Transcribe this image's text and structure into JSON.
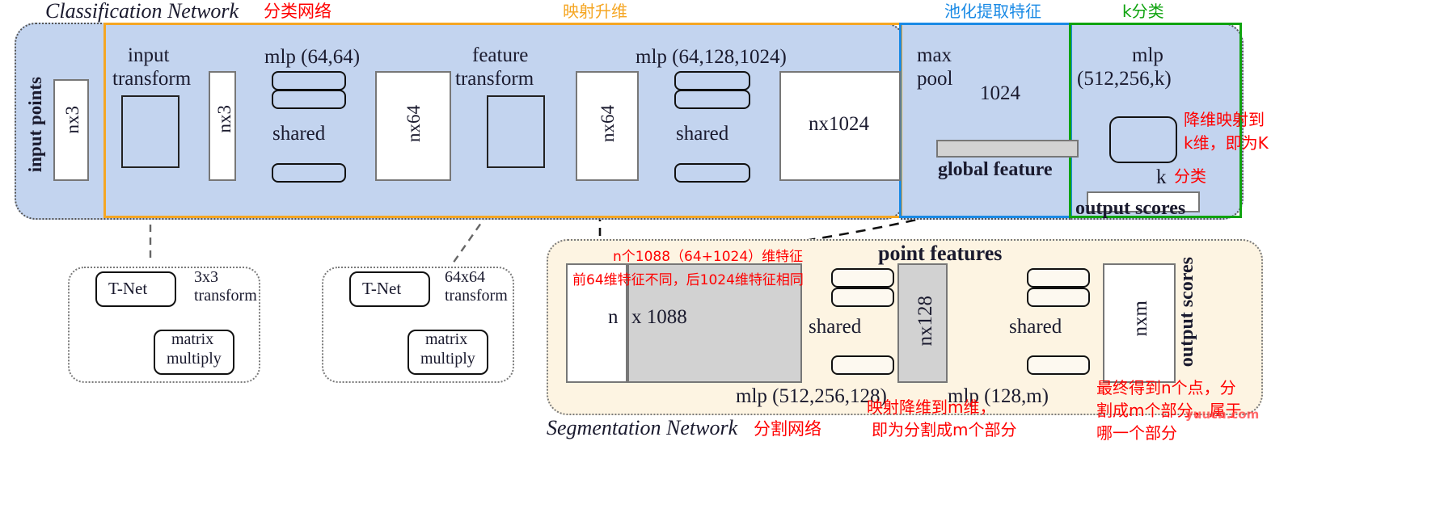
{
  "title": {
    "classification_en": "Classification Network",
    "classification_cn": "分类网络",
    "segmentation_en": "Segmentation Network",
    "segmentation_cn": "分割网络"
  },
  "region_labels": {
    "mapping_up_cn": "映射升维",
    "pooling_cn": "池化提取特征",
    "kclass_cn": "k分类"
  },
  "colors": {
    "orange": "#f5a623",
    "blue": "#1a8ae5",
    "green": "#0fa30f",
    "red": "#ff0000",
    "panel_blue": "#c3d4ef",
    "panel_cream": "#fdf4e2",
    "gray_box": "#d2d2d2"
  },
  "classification": {
    "input_points_label": "input points",
    "input_box": "nx3",
    "input_transform": "input\ntransform",
    "input_transform_line1": "input",
    "input_transform_line2": "transform",
    "after_transform_box": "nx3",
    "mlp1": "mlp (64,64)",
    "shared1": "shared",
    "nx64_a": "nx64",
    "feature_transform_line1": "feature",
    "feature_transform_line2": "transform",
    "nx64_b": "nx64",
    "mlp2": "mlp (64,128,1024)",
    "shared2": "shared",
    "nx1024": "nx1024",
    "max_line1": "max",
    "max_line2": "pool",
    "pool_dim": "1024",
    "global_feature": "global feature",
    "mlp3_line1": "mlp",
    "mlp3_line2": "(512,256,k)",
    "k_label": "k",
    "output_scores": "output scores"
  },
  "annotations_red": {
    "reduce_to_k_line1": "降维映射到",
    "reduce_to_k_line2": "k维，即为K",
    "k_class_cn": "分类",
    "feat_1088_line1": "n个1088（64+1024）维特征",
    "feat_1088_line2": "前64维特征不同，后1024维特征相同",
    "seg_reduce_line1": "映射降维到m维，",
    "seg_reduce_line2": "即为分割成m个部分",
    "seg_final_line1": "最终得到n个点，分",
    "seg_final_line2": "割成m个部分，属于",
    "seg_final_line3": "哪一个部分"
  },
  "tnet_left": {
    "tnet": "T-Net",
    "transform_line1": "3x3",
    "transform_line2": "transform",
    "matrix_line1": "matrix",
    "matrix_line2": "multiply"
  },
  "tnet_right": {
    "tnet": "T-Net",
    "transform_line1": "64x64",
    "transform_line2": "transform",
    "matrix_line1": "matrix",
    "matrix_line2": "multiply"
  },
  "segmentation": {
    "n_label": "n",
    "x1088_label": "x 1088",
    "point_features": "point features",
    "shared_a": "shared",
    "nx128": "nx128",
    "shared_b": "shared",
    "nxm": "nxm",
    "output_scores": "output scores",
    "mlp_seg1": "mlp (512,256,128)",
    "mlp_seg2": "mlp (128,m)"
  },
  "watermark": "yuucn.com"
}
